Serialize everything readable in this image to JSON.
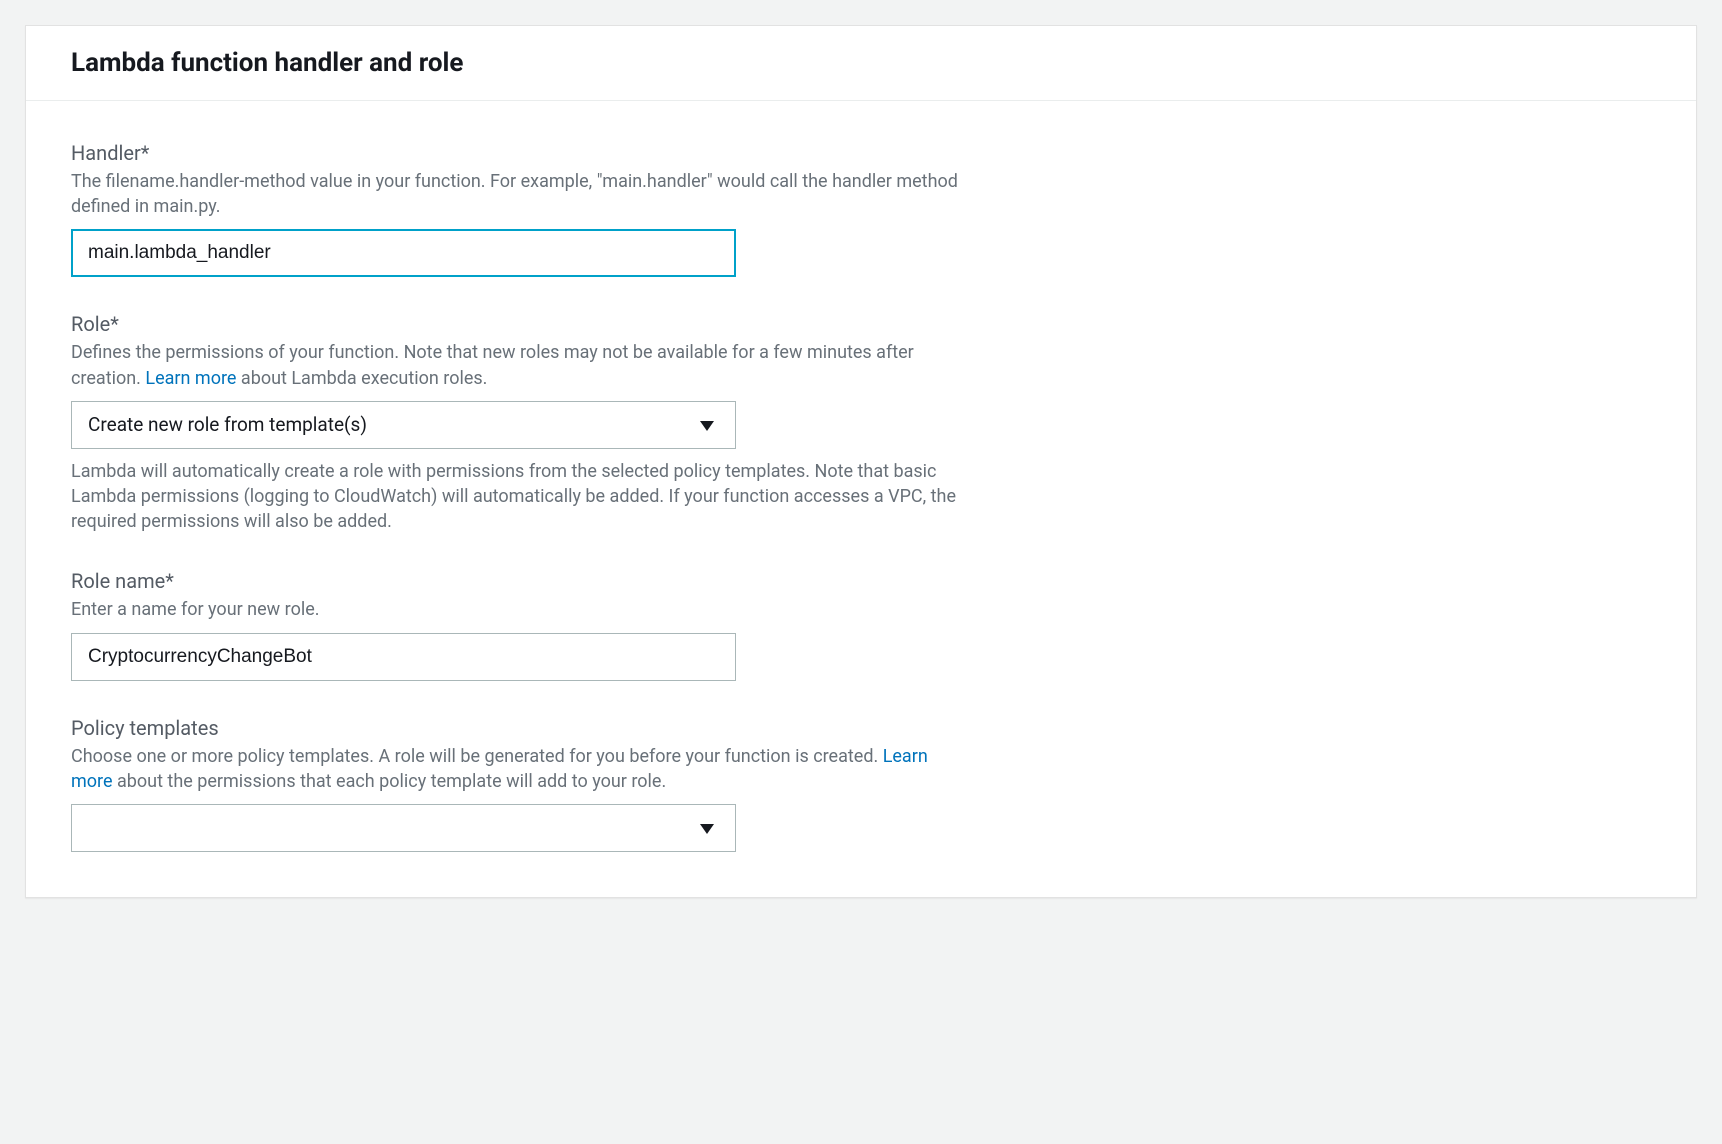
{
  "header": {
    "title": "Lambda function handler and role"
  },
  "handler": {
    "label": "Handler*",
    "description": "The filename.handler-method value in your function. For example, \"main.handler\" would call the handler method defined in main.py.",
    "value": "main.lambda_handler"
  },
  "role": {
    "label": "Role*",
    "desc_pre": "Defines the permissions of your function. Note that new roles may not be available for a few minutes after creation. ",
    "learn_more": "Learn more",
    "desc_post": " about Lambda execution roles.",
    "selected": "Create new role from template(s)",
    "note_below": "Lambda will automatically create a role with permissions from the selected policy templates. Note that basic Lambda permissions (logging to CloudWatch) will automatically be added. If your function accesses a VPC, the required permissions will also be added."
  },
  "roleName": {
    "label": "Role name*",
    "description": "Enter a name for your new role.",
    "value": "CryptocurrencyChangeBot"
  },
  "policyTemplates": {
    "label": "Policy templates",
    "desc_pre": "Choose one or more policy templates. A role will be generated for you before your function is created. ",
    "learn_more": "Learn more",
    "desc_post": " about the permissions that each policy template will add to your role.",
    "selected": ""
  }
}
